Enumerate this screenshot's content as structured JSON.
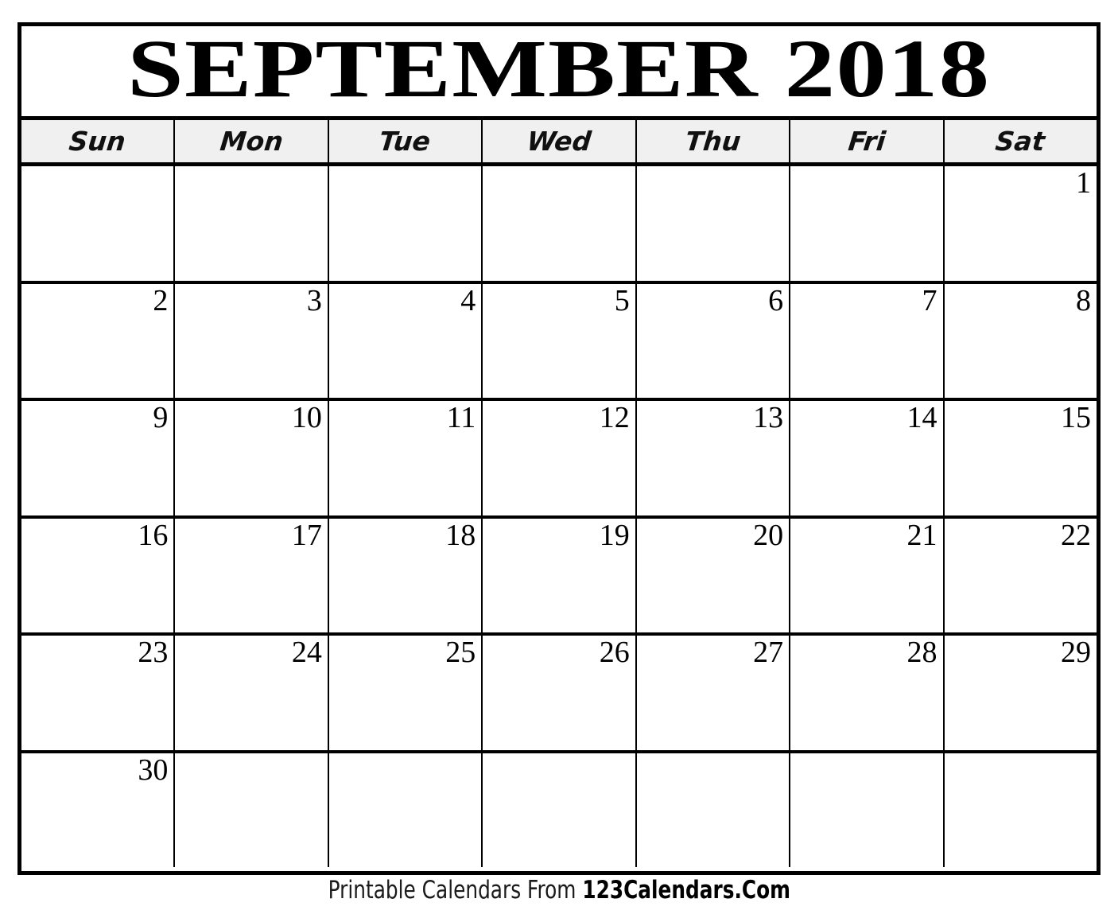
{
  "calendar": {
    "title": "SEPTEMBER 2018",
    "month": "SEPTEMBER",
    "year": "2018",
    "weekdays": [
      {
        "label": "Sun"
      },
      {
        "label": "Mon"
      },
      {
        "label": "Tue"
      },
      {
        "label": "Wed"
      },
      {
        "label": "Thu"
      },
      {
        "label": "Fri"
      },
      {
        "label": "Sat"
      }
    ],
    "weeks": [
      {
        "days": [
          {
            "date": ""
          },
          {
            "date": ""
          },
          {
            "date": ""
          },
          {
            "date": ""
          },
          {
            "date": ""
          },
          {
            "date": ""
          },
          {
            "date": "1"
          }
        ]
      },
      {
        "days": [
          {
            "date": "2"
          },
          {
            "date": "3"
          },
          {
            "date": "4"
          },
          {
            "date": "5"
          },
          {
            "date": "6"
          },
          {
            "date": "7"
          },
          {
            "date": "8"
          }
        ]
      },
      {
        "days": [
          {
            "date": "9"
          },
          {
            "date": "10"
          },
          {
            "date": "11"
          },
          {
            "date": "12"
          },
          {
            "date": "13"
          },
          {
            "date": "14"
          },
          {
            "date": "15"
          }
        ]
      },
      {
        "days": [
          {
            "date": "16"
          },
          {
            "date": "17"
          },
          {
            "date": "18"
          },
          {
            "date": "19"
          },
          {
            "date": "20"
          },
          {
            "date": "21"
          },
          {
            "date": "22"
          }
        ]
      },
      {
        "days": [
          {
            "date": "23"
          },
          {
            "date": "24"
          },
          {
            "date": "25"
          },
          {
            "date": "26"
          },
          {
            "date": "27"
          },
          {
            "date": "28"
          },
          {
            "date": "29"
          }
        ]
      },
      {
        "days": [
          {
            "date": "30"
          },
          {
            "date": ""
          },
          {
            "date": ""
          },
          {
            "date": ""
          },
          {
            "date": ""
          },
          {
            "date": ""
          },
          {
            "date": ""
          }
        ]
      }
    ]
  },
  "footer": {
    "prefix": "Printable Calendars From ",
    "brand": "123Calendars.Com"
  },
  "colors": {
    "border": "#000000",
    "header_background": "#f0f0f0",
    "page_background": "#ffffff",
    "text": "#000000"
  }
}
